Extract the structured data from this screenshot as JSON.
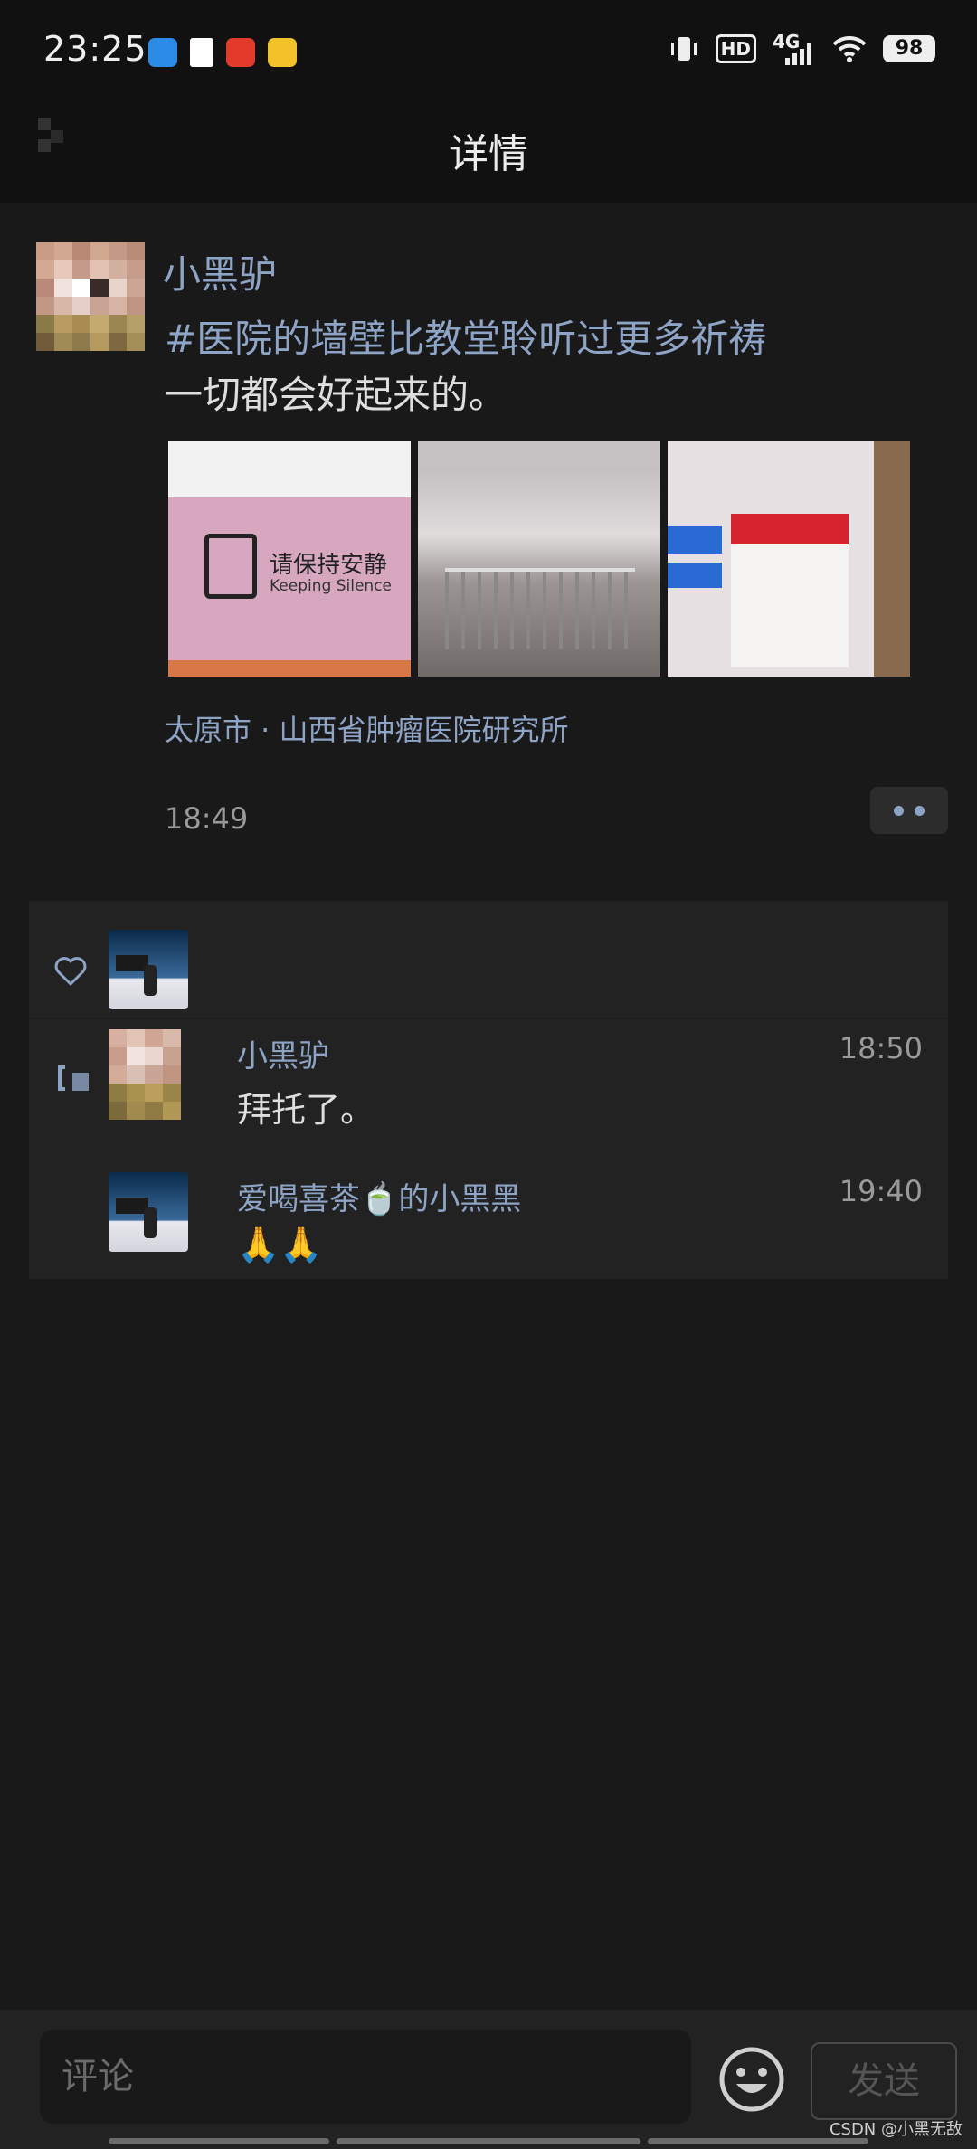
{
  "status_bar": {
    "time": "23:25",
    "hd_label": "HD",
    "network_label": "4G",
    "battery_level": "98",
    "app_icons": [
      "browser-icon",
      "book-icon",
      "shop-icon",
      "rewards-icon"
    ]
  },
  "nav": {
    "title": "详情"
  },
  "post": {
    "author": "小黑驴",
    "text_line1": "#医院的墙壁比教堂聆听过更多祈祷",
    "text_line2": "一切都会好起来的。",
    "photo1_sign": "请保持安静",
    "photo1_sub": "Keeping Silence",
    "location": "太原市 · 山西省肿瘤医院研究所",
    "time": "18:49"
  },
  "comments": [
    {
      "name": "小黑驴",
      "time": "18:50",
      "text": "拜托了。"
    },
    {
      "name": "爱喝喜茶🍵的小黑黑",
      "time": "19:40",
      "text": "🙏🙏"
    }
  ],
  "input": {
    "placeholder": "评论",
    "send_label": "发送"
  },
  "watermark": "CSDN @小黑无敌",
  "colors": {
    "background": "#191919",
    "link_blue": "#8ea4c6",
    "panel": "#222222"
  }
}
